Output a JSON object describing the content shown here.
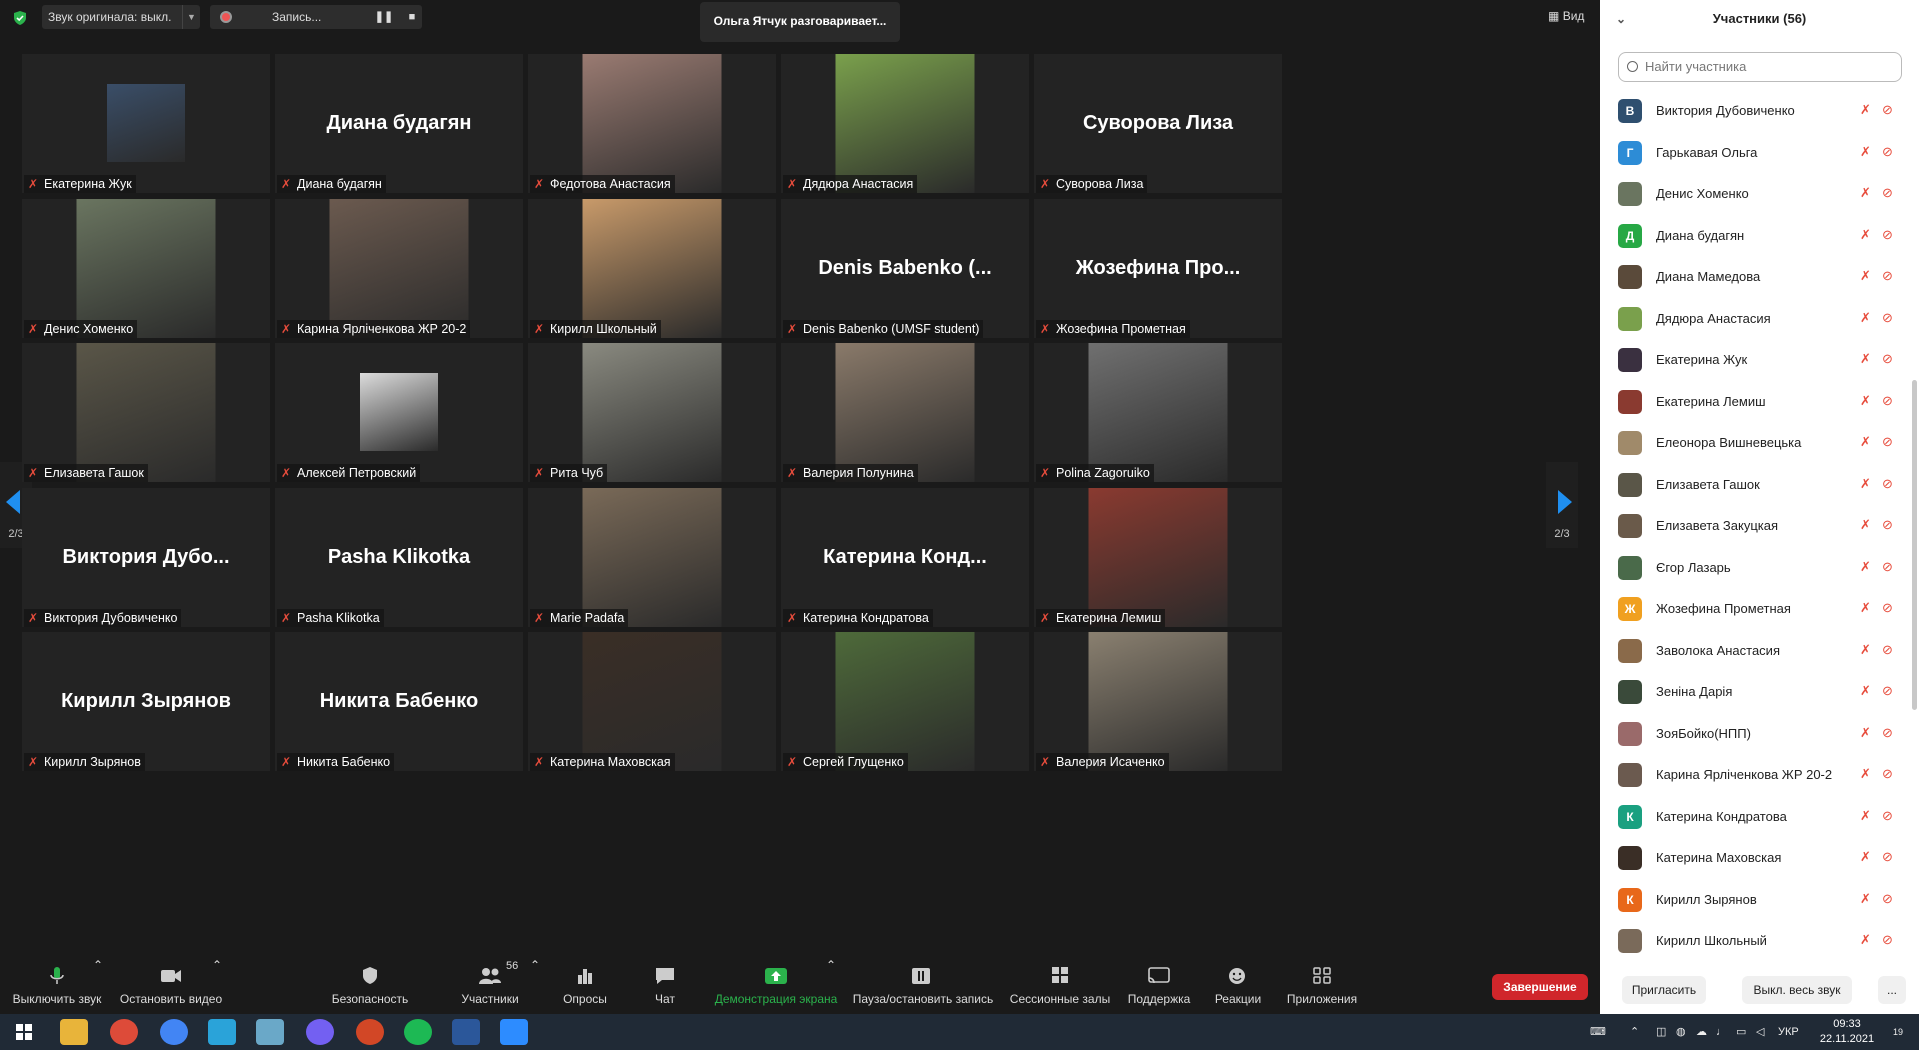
{
  "topbar": {
    "original_audio": "Звук оригинала: выкл.",
    "recording": "Запись...",
    "speaking": "Ольга Ятчук разговаривает...",
    "view": "Вид"
  },
  "page_indicator": "2/3",
  "tiles": [
    {
      "name": "Екатерина Жук",
      "big": "",
      "photo": "#3a4e68"
    },
    {
      "name": "Диана будагян",
      "big": "Диана будагян",
      "photo": ""
    },
    {
      "name": "Федотова Анастасия",
      "big": "",
      "photo": "#9a7b72"
    },
    {
      "name": "Дядюра Анастасия",
      "big": "",
      "photo": "#7aa04c"
    },
    {
      "name": "Суворова Лиза",
      "big": "Суворова Лиза",
      "photo": ""
    },
    {
      "name": "Денис Хоменко",
      "big": "",
      "photo": "#6a7560"
    },
    {
      "name": "Карина Ярліченкова ЖР 20-2",
      "big": "",
      "photo": "#6b5a4f"
    },
    {
      "name": "Кирилл Школьный",
      "big": "",
      "photo": "#c89a6a"
    },
    {
      "name": "Denis Babenko (UMSF student)",
      "big": "Denis Babenko (...",
      "photo": ""
    },
    {
      "name": "Жозефина Прометная",
      "big": "Жозефина Про...",
      "photo": ""
    },
    {
      "name": "Елизавета Гашок",
      "big": "",
      "photo": "#5a5648"
    },
    {
      "name": "Алексей Петровский",
      "big": "",
      "photo": "#dcdcdc"
    },
    {
      "name": "Рита Чуб",
      "big": "",
      "photo": "#8a8a80"
    },
    {
      "name": "Валерия Полунина",
      "big": "",
      "photo": "#8a7a6a"
    },
    {
      "name": "Polina Zagoruiko",
      "big": "",
      "photo": "#707070"
    },
    {
      "name": "Виктория Дубовиченко",
      "big": "Виктория  Дубо...",
      "photo": ""
    },
    {
      "name": "Pasha Klikotka",
      "big": "Pasha Klikotka",
      "photo": ""
    },
    {
      "name": "Marie Padafa",
      "big": "",
      "photo": "#7a6a58"
    },
    {
      "name": "Катерина Кондратова",
      "big": "Катерина  Конд...",
      "photo": ""
    },
    {
      "name": "Екатерина Лемиш",
      "big": "",
      "photo": "#8a3a30"
    },
    {
      "name": "Кирилл Зырянов",
      "big": "Кирилл Зырянов",
      "photo": ""
    },
    {
      "name": "Никита Бабенко",
      "big": "Никита Бабенко",
      "photo": ""
    },
    {
      "name": "Катерина Маховская",
      "big": "",
      "photo": "#3a2e26"
    },
    {
      "name": "Сергей Глущенко",
      "big": "",
      "photo": "#4e6a3a"
    },
    {
      "name": "Валерия Исаченко",
      "big": "",
      "photo": "#8a8070"
    }
  ],
  "toolbar": {
    "mute": "Выключить звук",
    "video": "Остановить видео",
    "security": "Безопасность",
    "participants": "Участники",
    "participants_count": "56",
    "polls": "Опросы",
    "chat": "Чат",
    "share": "Демонстрация экрана",
    "pause_rec": "Пауза/остановить запись",
    "breakout": "Сессионные залы",
    "support": "Поддержка",
    "reactions": "Реакции",
    "apps": "Приложения",
    "end": "Завершение"
  },
  "panel": {
    "title": "Участники (56)",
    "search_placeholder": "Найти участника",
    "invite": "Пригласить",
    "mute_all": "Выкл. весь звук",
    "more": "...",
    "participants": [
      {
        "name": "Виктория Дубовиченко",
        "letter": "В",
        "color": "#2f4f6f"
      },
      {
        "name": "Гарькавая Ольга",
        "letter": "Г",
        "color": "#2d8cd6"
      },
      {
        "name": "Денис Хоменко",
        "letter": "",
        "color": "#6a7560"
      },
      {
        "name": "Диана будагян",
        "letter": "Д",
        "color": "#27a845"
      },
      {
        "name": "Диана Мамедова",
        "letter": "",
        "color": "#5a4a3a"
      },
      {
        "name": "Дядюра Анастасия",
        "letter": "",
        "color": "#7aa04c"
      },
      {
        "name": "Екатерина Жук",
        "letter": "",
        "color": "#3a3040"
      },
      {
        "name": "Екатерина Лемиш",
        "letter": "",
        "color": "#8a3a30"
      },
      {
        "name": "Елеонора Вишневецька",
        "letter": "",
        "color": "#a08a6a"
      },
      {
        "name": "Елизавета Гашок",
        "letter": "",
        "color": "#5a5648"
      },
      {
        "name": "Елизавета Закуцкая",
        "letter": "",
        "color": "#6a5a4a"
      },
      {
        "name": "Єгор Лазарь",
        "letter": "",
        "color": "#4a6a4a"
      },
      {
        "name": "Жозефина Прометная",
        "letter": "Ж",
        "color": "#f0a020"
      },
      {
        "name": "Заволока Анастасия",
        "letter": "",
        "color": "#8a6a4a"
      },
      {
        "name": "Зеніна Дарія",
        "letter": "",
        "color": "#3a4a3a"
      },
      {
        "name": "ЗояБойко(НПП)",
        "letter": "",
        "color": "#9a6a6a"
      },
      {
        "name": "Карина Ярліченкова ЖР 20-2",
        "letter": "",
        "color": "#6b5a4f"
      },
      {
        "name": "Катерина Кондратова",
        "letter": "К",
        "color": "#1aa080"
      },
      {
        "name": "Катерина Маховская",
        "letter": "",
        "color": "#3a2e26"
      },
      {
        "name": "Кирилл Зырянов",
        "letter": "К",
        "color": "#e8681a"
      },
      {
        "name": "Кирилл Школьный",
        "letter": "",
        "color": "#7a6a5a"
      }
    ]
  },
  "taskbar": {
    "lang": "УКР",
    "time": "09:33",
    "date": "22.11.2021",
    "notif": "19"
  }
}
